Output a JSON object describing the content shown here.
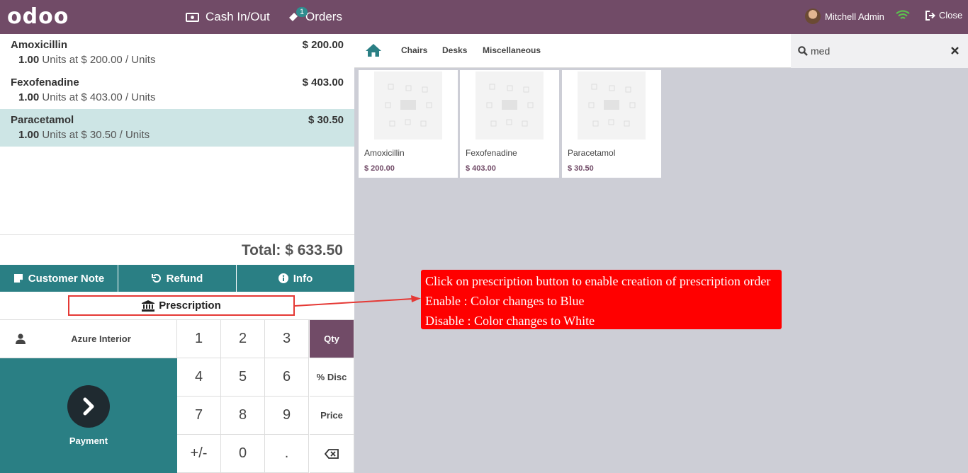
{
  "header": {
    "logo": "odoo",
    "cash_in_out": "Cash In/Out",
    "orders": "Orders",
    "orders_badge": "1",
    "user_name": "Mitchell Admin",
    "close": "Close"
  },
  "order_lines": [
    {
      "name": "Amoxicillin",
      "price": "$ 200.00",
      "qty": "1.00",
      "detail": " Units at $ 200.00 / Units"
    },
    {
      "name": "Fexofenadine",
      "price": "$ 403.00",
      "qty": "1.00",
      "detail": " Units at $ 403.00 / Units"
    },
    {
      "name": "Paracetamol",
      "price": "$ 30.50",
      "qty": "1.00",
      "detail": " Units at $ 30.50 / Units"
    }
  ],
  "total": "Total: $ 633.50",
  "controls": {
    "customer_note": "Customer Note",
    "refund": "Refund",
    "info": "Info",
    "prescription": "Prescription"
  },
  "customer": "Azure Interior",
  "payment": "Payment",
  "numpad": {
    "keys": [
      "1",
      "2",
      "3",
      "4",
      "5",
      "6",
      "7",
      "8",
      "9",
      "+/-",
      "0",
      "."
    ],
    "qty": "Qty",
    "disc": "% Disc",
    "price": "Price"
  },
  "categories": [
    "Chairs",
    "Desks",
    "Miscellaneous"
  ],
  "search": {
    "value": "med"
  },
  "products": [
    {
      "name": "Amoxicillin",
      "price": "$ 200.00"
    },
    {
      "name": "Fexofenadine",
      "price": "$ 403.00"
    },
    {
      "name": "Paracetamol",
      "price": "$ 30.50"
    }
  ],
  "annotation": {
    "line1": "Click on prescription button to enable creation of prescription order",
    "line2": "Enable : Color changes to Blue",
    "line3": "Disable : Color changes to White"
  },
  "colors": {
    "header": "#714b67",
    "teal": "#2a7f84",
    "selected_line": "#cde5e5",
    "annotation": "#ff0000"
  }
}
